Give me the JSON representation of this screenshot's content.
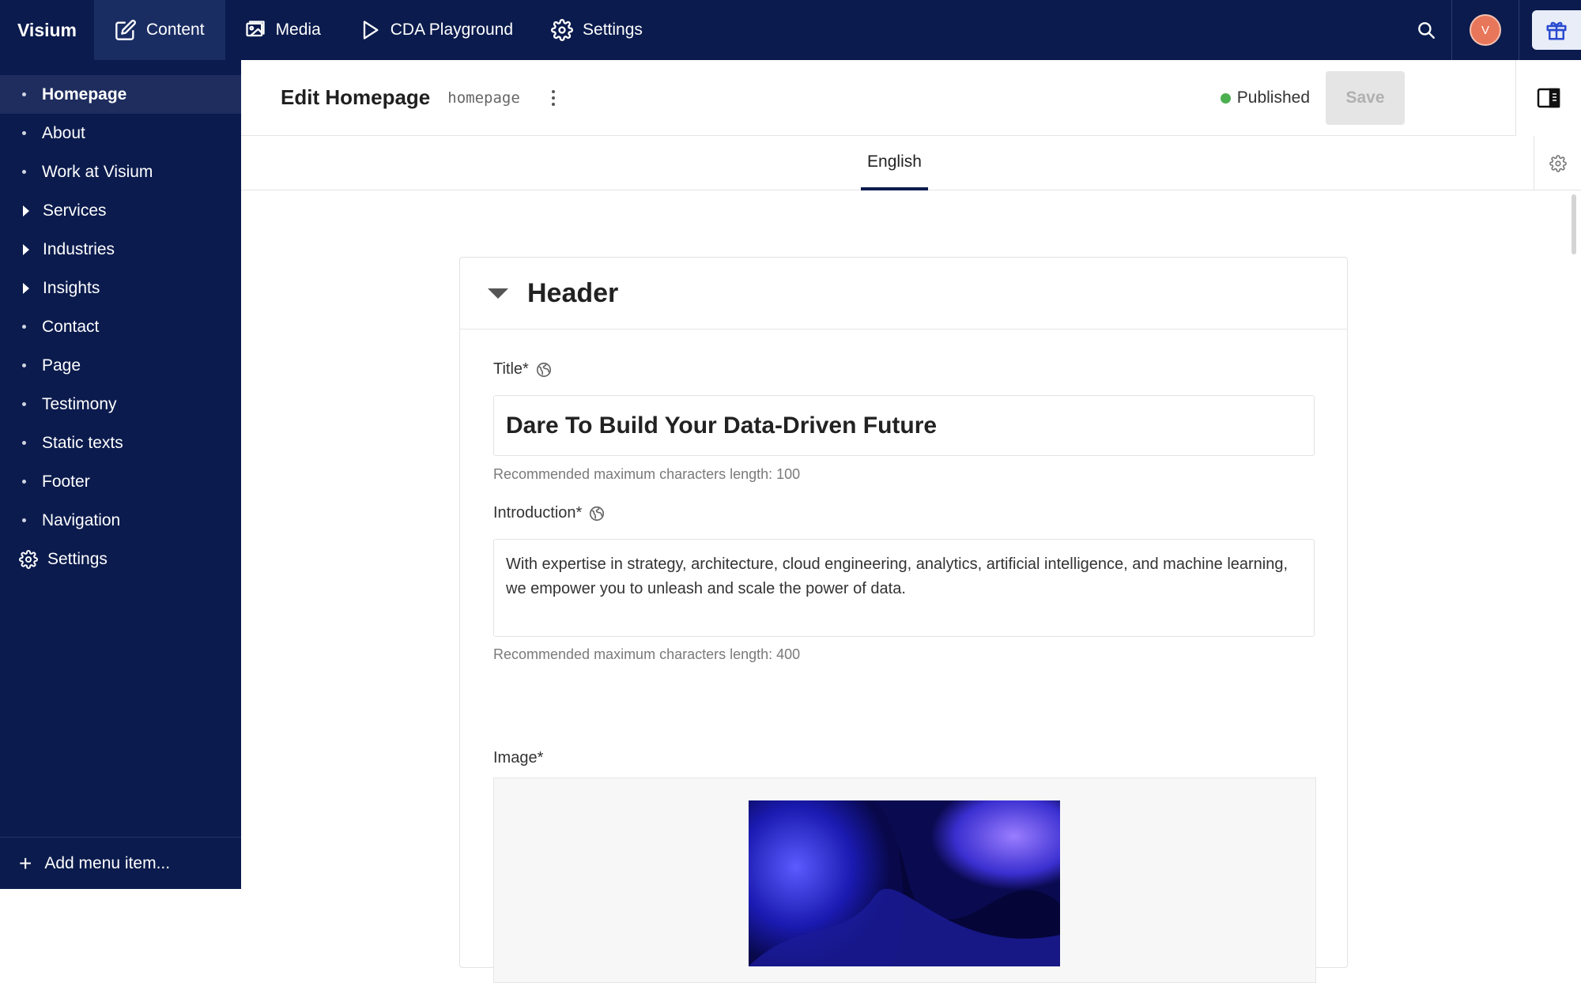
{
  "app": {
    "brand": "Visium"
  },
  "topnav": {
    "items": [
      {
        "label": "Content",
        "icon": "edit-icon",
        "active": true
      },
      {
        "label": "Media",
        "icon": "image-icon"
      },
      {
        "label": "CDA Playground",
        "icon": "play-icon"
      },
      {
        "label": "Settings",
        "icon": "gear-icon"
      }
    ],
    "avatar_initial": "V"
  },
  "sidebar": {
    "items": [
      {
        "label": "Homepage",
        "type": "bullet",
        "active": true
      },
      {
        "label": "About",
        "type": "bullet"
      },
      {
        "label": "Work at Visium",
        "type": "bullet"
      },
      {
        "label": "Services",
        "type": "expandable"
      },
      {
        "label": "Industries",
        "type": "expandable"
      },
      {
        "label": "Insights",
        "type": "expandable"
      },
      {
        "label": "Contact",
        "type": "bullet"
      },
      {
        "label": "Page",
        "type": "bullet"
      },
      {
        "label": "Testimony",
        "type": "bullet"
      },
      {
        "label": "Static texts",
        "type": "bullet"
      },
      {
        "label": "Footer",
        "type": "bullet"
      },
      {
        "label": "Navigation",
        "type": "bullet"
      },
      {
        "label": "Settings",
        "type": "gear"
      }
    ],
    "add_label": "Add menu item..."
  },
  "editor": {
    "title": "Edit Homepage",
    "slug": "homepage",
    "status": "Published",
    "status_color": "#4caf50",
    "save_label": "Save",
    "locale_tab": "English"
  },
  "card": {
    "title": "Header",
    "fields": {
      "title_label": "Title*",
      "title_value": "Dare To Build Your Data-Driven Future",
      "title_hint": "Recommended maximum characters length: 100",
      "intro_label": "Introduction*",
      "intro_value": "With expertise in strategy, architecture, cloud engineering, analytics, artificial intelligence, and machine learning, we empower you to unleash and scale the power of data.",
      "intro_hint": "Recommended maximum characters length: 400",
      "image_label": "Image*"
    }
  },
  "colors": {
    "nav_bg": "#0b1b4d",
    "accent": "#0b1b4d",
    "avatar": "#e8765a"
  }
}
